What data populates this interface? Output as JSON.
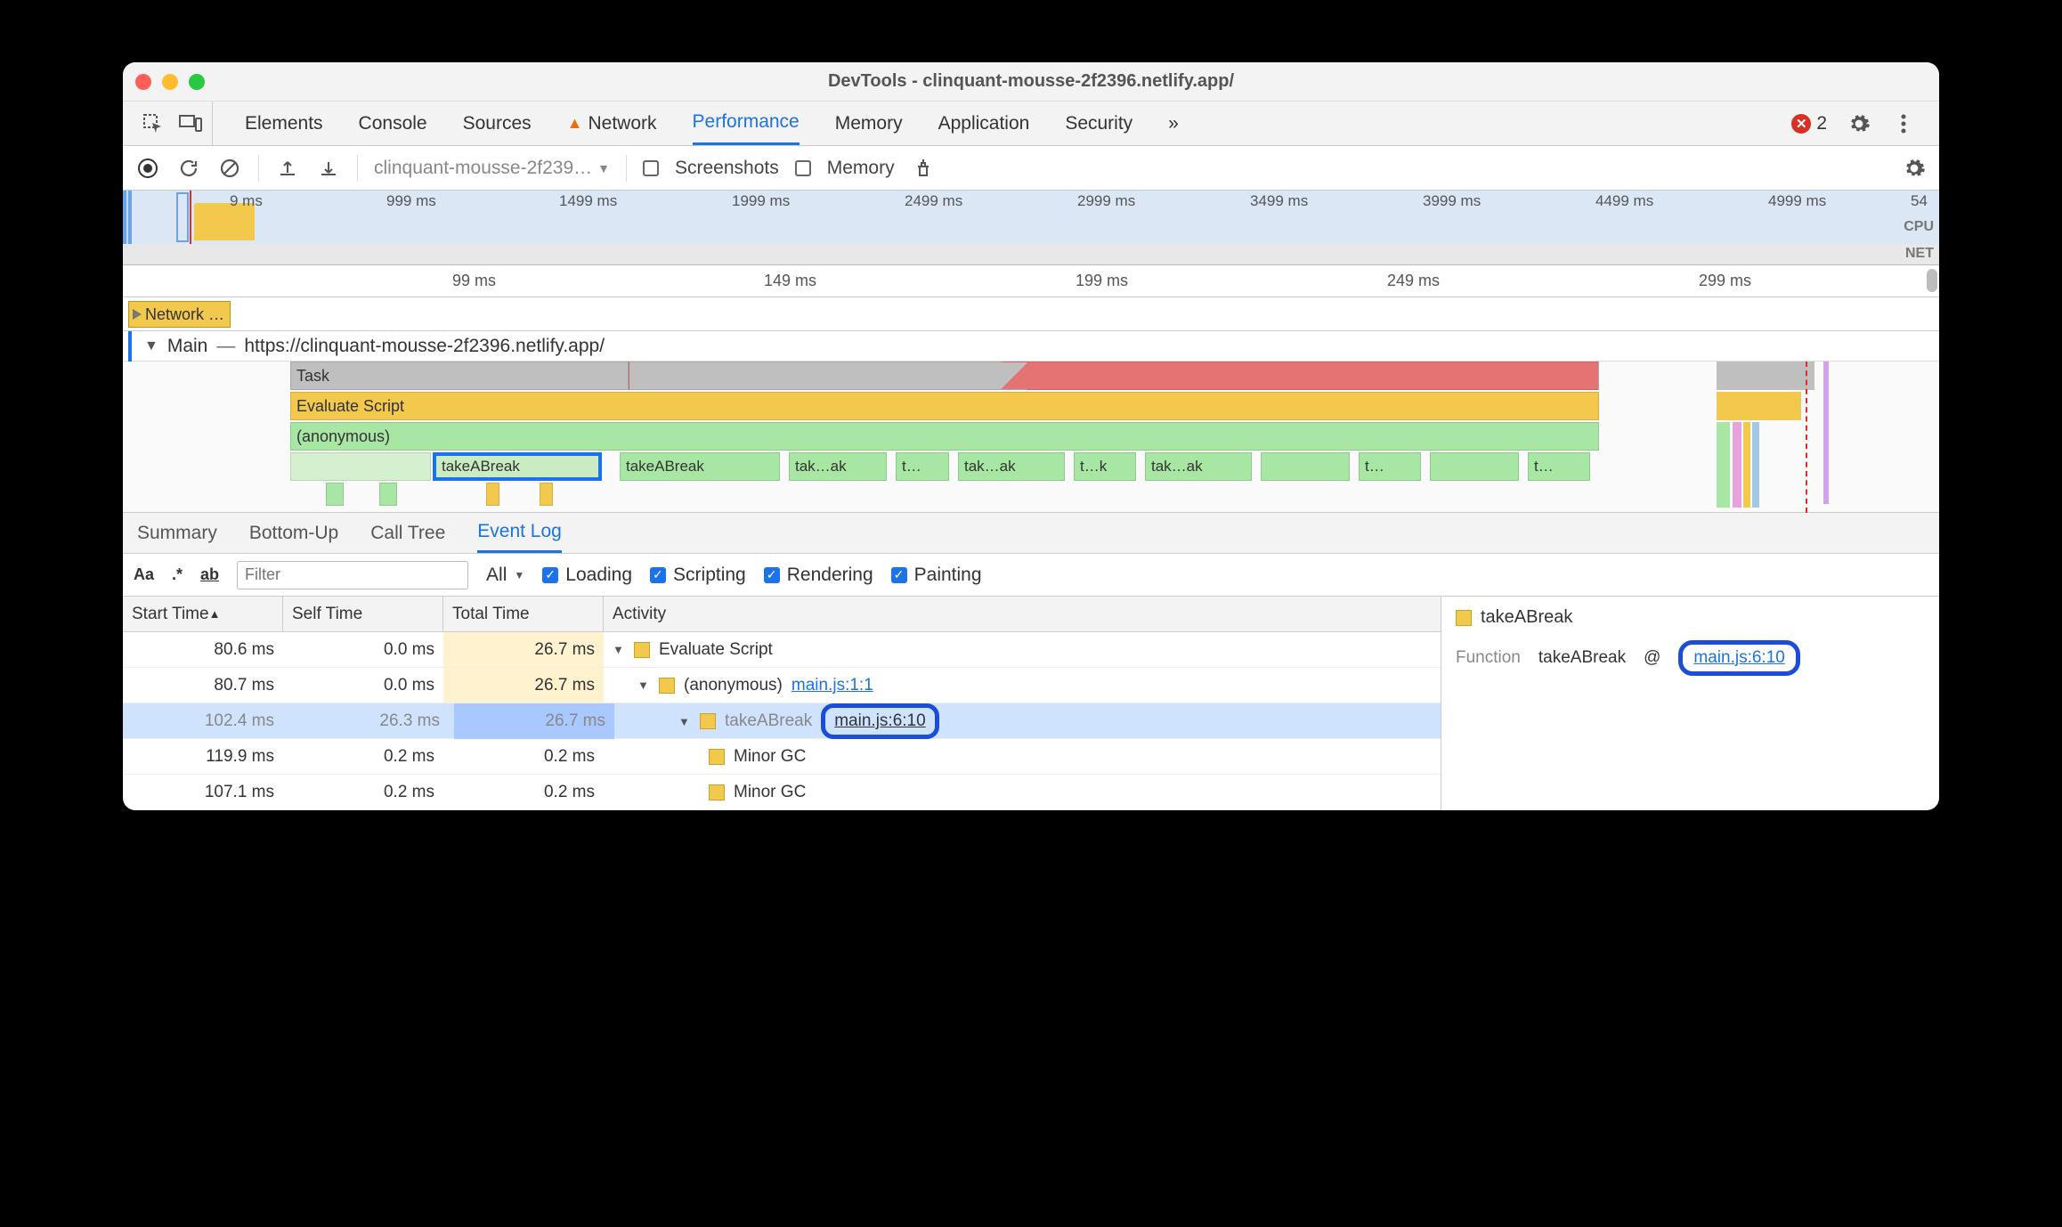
{
  "window": {
    "title": "DevTools - clinquant-mousse-2f2396.netlify.app/"
  },
  "tabs": {
    "items": [
      "Elements",
      "Console",
      "Sources",
      "Network",
      "Performance",
      "Memory",
      "Application",
      "Security"
    ],
    "network_warn": true,
    "active": "Performance",
    "more": "»",
    "error_count": "2"
  },
  "toolbar": {
    "profile_select": "clinquant-mousse-2f239…",
    "screenshots_label": "Screenshots",
    "memory_label": "Memory"
  },
  "overview": {
    "ticks": [
      "9 ms",
      "999 ms",
      "1499 ms",
      "1999 ms",
      "2499 ms",
      "2999 ms",
      "3499 ms",
      "3999 ms",
      "4499 ms",
      "4999 ms",
      "54"
    ],
    "cpu_label": "CPU",
    "net_label": "NET"
  },
  "ruler": {
    "ticks": [
      "99 ms",
      "149 ms",
      "199 ms",
      "249 ms",
      "299 ms"
    ]
  },
  "tracks": {
    "network_label": "Network …",
    "main_label": "Main",
    "main_url": "https://clinquant-mousse-2f2396.netlify.app/",
    "task": "Task",
    "evaluate": "Evaluate Script",
    "anonymous": "(anonymous)",
    "fns": [
      "takeABreak",
      "takeABreak",
      "tak…ak",
      "t…",
      "tak…ak",
      "t…k",
      "tak…ak",
      "t…",
      "t…"
    ]
  },
  "subtabs": {
    "items": [
      "Summary",
      "Bottom-Up",
      "Call Tree",
      "Event Log"
    ],
    "active": "Event Log"
  },
  "filter": {
    "aa": "Aa",
    "regex": ".*",
    "ab": "ab",
    "placeholder": "Filter",
    "all": "All",
    "loading": "Loading",
    "scripting": "Scripting",
    "rendering": "Rendering",
    "painting": "Painting"
  },
  "table": {
    "headers": {
      "start": "Start Time",
      "self": "Self Time",
      "total": "Total Time",
      "activity": "Activity"
    },
    "rows": [
      {
        "start": "80.6 ms",
        "self": "0.0 ms",
        "total": "26.7 ms",
        "indent": 0,
        "disc": true,
        "label": "Evaluate Script",
        "src": ""
      },
      {
        "start": "80.7 ms",
        "self": "0.0 ms",
        "total": "26.7 ms",
        "indent": 1,
        "disc": true,
        "label": "(anonymous)",
        "src": "main.js:1:1"
      },
      {
        "start": "102.4 ms",
        "self": "26.3 ms",
        "total": "26.7 ms",
        "indent": 2,
        "disc": true,
        "label": "takeABreak",
        "src": "main.js:6:10",
        "selected": true,
        "boxsrc": true
      },
      {
        "start": "119.9 ms",
        "self": "0.2 ms",
        "total": "0.2 ms",
        "indent": 3,
        "disc": false,
        "label": "Minor GC",
        "src": ""
      },
      {
        "start": "107.1 ms",
        "self": "0.2 ms",
        "total": "0.2 ms",
        "indent": 3,
        "disc": false,
        "label": "Minor GC",
        "src": ""
      }
    ]
  },
  "details": {
    "title": "takeABreak",
    "fn_label": "Function",
    "fn_name": "takeABreak",
    "at": "@",
    "src": "main.js:6:10"
  }
}
